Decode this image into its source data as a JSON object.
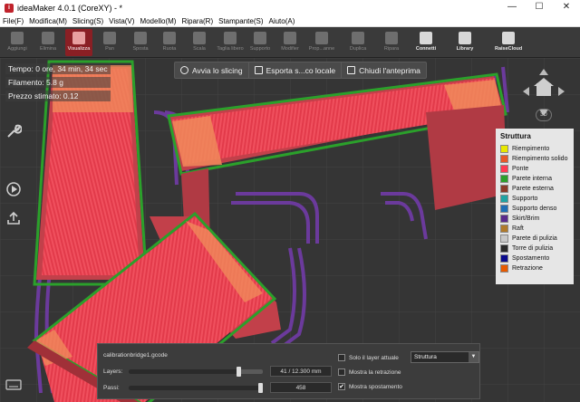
{
  "window": {
    "title": "ideaMaker 4.0.1 (CoreXY) - *",
    "app_icon": "ideamaker-logo-icon"
  },
  "window_controls": {
    "minimize": "—",
    "maximize": "☐",
    "close": "✕"
  },
  "menu": [
    {
      "label": "File(F)"
    },
    {
      "label": "Modifica(M)"
    },
    {
      "label": "Slicing(S)"
    },
    {
      "label": "Vista(V)"
    },
    {
      "label": "Modello(M)"
    },
    {
      "label": "Ripara(R)"
    },
    {
      "label": "Stampante(S)"
    },
    {
      "label": "Aiuto(A)"
    }
  ],
  "toolbar": [
    {
      "label": "Aggiungi",
      "icon": "add-icon"
    },
    {
      "label": "Elimina",
      "icon": "trash-icon"
    },
    {
      "label": "Visualizza",
      "icon": "eye-icon"
    },
    {
      "label": "Pan",
      "icon": "hand-icon"
    },
    {
      "label": "Sposta",
      "icon": "move-icon"
    },
    {
      "label": "Ruota",
      "icon": "rotate-icon"
    },
    {
      "label": "Scala",
      "icon": "scale-icon"
    },
    {
      "label": "Taglia libero",
      "icon": "cut-icon"
    },
    {
      "label": "Supporto",
      "icon": "support-icon"
    },
    {
      "label": "Modifier",
      "icon": "modifier-icon"
    },
    {
      "label": "Prop...anne",
      "icon": "properties-icon"
    },
    {
      "label": "Duplica",
      "icon": "duplicate-icon"
    },
    {
      "label": "Ripara",
      "icon": "repair-icon"
    },
    {
      "label": "Connetti",
      "icon": "connect-icon"
    },
    {
      "label": "Library",
      "icon": "library-icon"
    },
    {
      "label": "RaiseCloud",
      "icon": "cloud-icon"
    }
  ],
  "stats": {
    "time": "Tempo: 0 ore, 34 min, 34 sec",
    "filament": "Filamento: 5.8 g",
    "price": "Prezzo stimato: 0.12"
  },
  "actions": {
    "start_slicing": "Avvia lo slicing",
    "export_local": "Esporta s...co locale",
    "close_preview": "Chiudi l'anteprima"
  },
  "nav": {
    "view_label": "3D"
  },
  "legend": {
    "title": "Struttura",
    "items": [
      {
        "label": "Riempimento",
        "color": "#e8e800"
      },
      {
        "label": "Riempimento solido",
        "color": "#e8582a"
      },
      {
        "label": "Ponte",
        "color": "#ff3a52"
      },
      {
        "label": "Parete interna",
        "color": "#2ba02b"
      },
      {
        "label": "Parete esterna",
        "color": "#8c3a2a"
      },
      {
        "label": "Supporto",
        "color": "#1fa3a3"
      },
      {
        "label": "Supporto denso",
        "color": "#1f6fb5"
      },
      {
        "label": "Skirt/Brim",
        "color": "#5a2a8c"
      },
      {
        "label": "Raft",
        "color": "#b07a2a"
      },
      {
        "label": "Parete di pulizia",
        "color": "#c8c8c8"
      },
      {
        "label": "Torre di pulizia",
        "color": "#2a2a2a"
      },
      {
        "label": "Spostamento",
        "color": "#0a0a8c"
      },
      {
        "label": "Retrazione",
        "color": "#e85a00"
      }
    ]
  },
  "layers": {
    "filename": "calibrationbridge1.gcode",
    "layers_label": "Layers:",
    "layers_value": "41 / 12.300 mm",
    "layers_fraction": 0.82,
    "steps_label": "Passi:",
    "steps_value": "458",
    "steps_fraction": 0.98,
    "only_current_layer": {
      "label": "Solo il layer attuale",
      "checked": false
    },
    "show_retraction": {
      "label": "Mostra la retrazione",
      "checked": false
    },
    "show_travel": {
      "label": "Mostra spostamento",
      "checked": true
    },
    "view_mode": "Struttura"
  }
}
